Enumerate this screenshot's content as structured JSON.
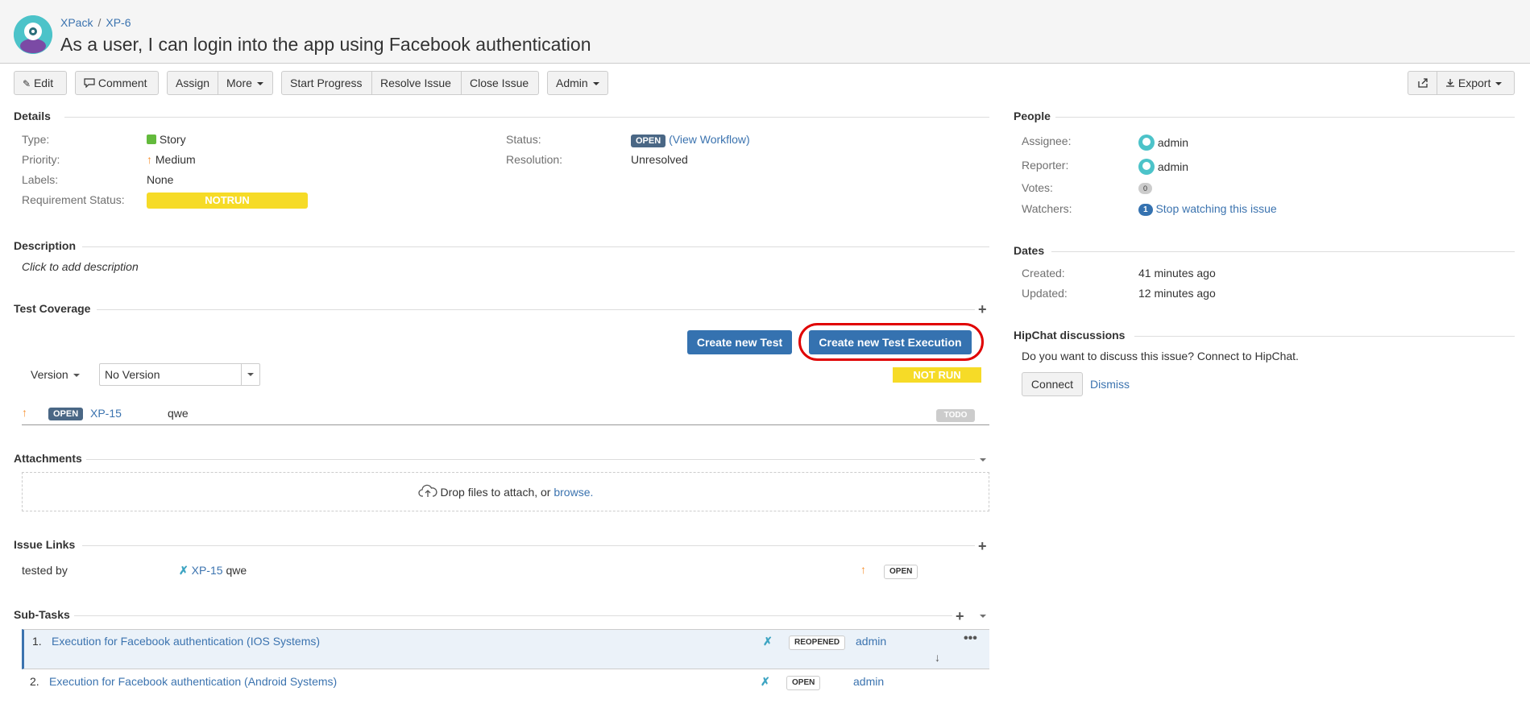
{
  "breadcrumb": {
    "project": "XPack",
    "issue_key": "XP-6"
  },
  "title": "As a user, I can login into the app using Facebook authentication",
  "toolbar": {
    "edit": "Edit",
    "comment": "Comment",
    "assign": "Assign",
    "more": "More",
    "start_progress": "Start Progress",
    "resolve_issue": "Resolve Issue",
    "close_issue": "Close Issue",
    "admin": "Admin",
    "export": "Export"
  },
  "details": {
    "title": "Details",
    "type_label": "Type:",
    "type_value": "Story",
    "priority_label": "Priority:",
    "priority_value": "Medium",
    "labels_label": "Labels:",
    "labels_value": "None",
    "req_status_label": "Requirement Status:",
    "req_status_value": "NOTRUN",
    "status_label": "Status:",
    "status_value": "OPEN",
    "view_workflow": "View Workflow",
    "resolution_label": "Resolution:",
    "resolution_value": "Unresolved"
  },
  "description": {
    "title": "Description",
    "placeholder": "Click to add description"
  },
  "test_coverage": {
    "title": "Test Coverage",
    "create_test": "Create new Test",
    "create_execution": "Create new Test Execution",
    "version_label": "Version",
    "version_value": "No Version",
    "coverage_status": "NOT RUN",
    "test_row": {
      "status": "OPEN",
      "key": "XP-15",
      "summary": "qwe",
      "run_status": "TODO"
    }
  },
  "attachments": {
    "title": "Attachments",
    "drop_text": "Drop files to attach, or",
    "browse": "browse."
  },
  "issue_links": {
    "title": "Issue Links",
    "relation": "tested by",
    "key": "XP-15",
    "summary": "qwe",
    "status": "OPEN"
  },
  "subtasks": {
    "title": "Sub-Tasks",
    "items": [
      {
        "num": "1.",
        "summary": "Execution for Facebook authentication (IOS Systems)",
        "status": "REOPENED",
        "assignee": "admin"
      },
      {
        "num": "2.",
        "summary": "Execution for Facebook authentication (Android Systems)",
        "status": "OPEN",
        "assignee": "admin"
      }
    ]
  },
  "people": {
    "title": "People",
    "assignee_label": "Assignee:",
    "assignee_value": "admin",
    "reporter_label": "Reporter:",
    "reporter_value": "admin",
    "votes_label": "Votes:",
    "votes_value": "0",
    "watchers_label": "Watchers:",
    "watchers_count": "1",
    "watchers_link": "Stop watching this issue"
  },
  "dates": {
    "title": "Dates",
    "created_label": "Created:",
    "created_value": "41 minutes ago",
    "updated_label": "Updated:",
    "updated_value": "12 minutes ago"
  },
  "hipchat": {
    "title": "HipChat discussions",
    "text": "Do you want to discuss this issue? Connect to HipChat.",
    "connect": "Connect",
    "dismiss": "Dismiss"
  },
  "colors": {
    "link": "#3b73af",
    "primary": "#3572b0",
    "yellow": "#f6db27",
    "highlight": "#e00000"
  }
}
